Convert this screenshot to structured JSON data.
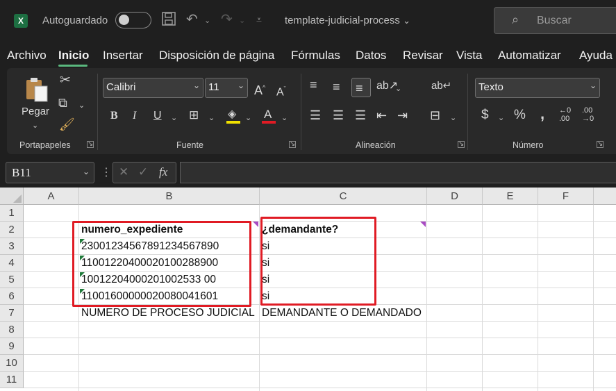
{
  "titlebar": {
    "autosave_label": "Autoguardado",
    "filename": "template-judicial-process",
    "search_placeholder": "Buscar"
  },
  "menu": [
    "Archivo",
    "Inicio",
    "Insertar",
    "Disposición de página",
    "Fórmulas",
    "Datos",
    "Revisar",
    "Vista",
    "Automatizar",
    "Ayuda"
  ],
  "ribbon": {
    "paste_label": "Pegar",
    "font_name": "Calibri",
    "font_size": "11",
    "number_format": "Texto",
    "groups": [
      "Portapapeles",
      "Fuente",
      "Alineación",
      "Número"
    ]
  },
  "formula_bar": {
    "name_box": "B11",
    "fx": "fx",
    "value": ""
  },
  "sheet": {
    "columns": [
      "A",
      "B",
      "C",
      "D",
      "E",
      "F"
    ],
    "rows": [
      "1",
      "2",
      "3",
      "4",
      "5",
      "6",
      "7",
      "8",
      "9",
      "10",
      "11"
    ],
    "b2": "numero_expediente",
    "b3": "23001234567891234567890",
    "b4": "11001220400020100288900",
    "b5": "10012204000201002533 00",
    "b6": "11001600000020080041601",
    "b7": "NUMERO DE PROCESO JUDICIAL",
    "c2": "¿demandante?",
    "c3": "si",
    "c4": "si",
    "c5": "si",
    "c6": "si",
    "c7": "DEMANDANTE O DEMANDADO"
  }
}
